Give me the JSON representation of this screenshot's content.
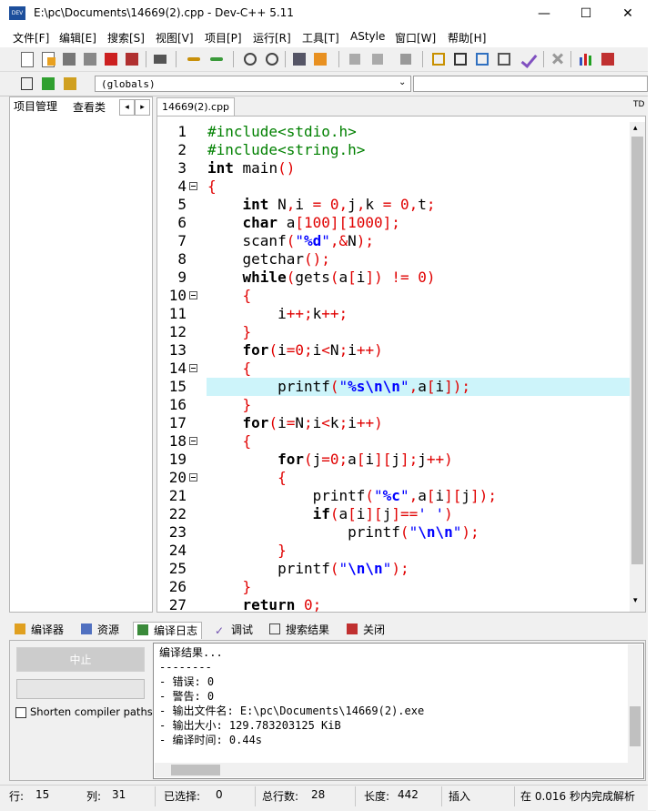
{
  "window": {
    "title": "E:\\pc\\Documents\\14669(2).cpp - Dev-C++ 5.11",
    "minimize": "—",
    "maximize": "☐",
    "close": "✕"
  },
  "menu": [
    "文件[F]",
    "编辑[E]",
    "搜索[S]",
    "视图[V]",
    "项目[P]",
    "运行[R]",
    "工具[T]",
    "AStyle",
    "窗口[W]",
    "帮助[H]"
  ],
  "toolbar": {
    "globals_value": "(globals)",
    "right_cut_label": "TD"
  },
  "left_panel": {
    "tabs": [
      "项目管理",
      "查看类"
    ],
    "nav_prev": "◂",
    "nav_next": "▸"
  },
  "editor": {
    "tab_label": "14669(2).cpp",
    "current_line": 15,
    "line_numbers": [
      "1",
      "2",
      "3",
      "4",
      "5",
      "6",
      "7",
      "8",
      "9",
      "10",
      "11",
      "12",
      "13",
      "14",
      "15",
      "16",
      "17",
      "18",
      "19",
      "20",
      "21",
      "22",
      "23",
      "24",
      "25",
      "26",
      "27"
    ],
    "fold_lines": [
      4,
      10,
      14,
      18,
      20
    ]
  },
  "bottom_tabs": [
    "编译器",
    "资源",
    "编译日志",
    "调试",
    "搜索结果",
    "关闭"
  ],
  "bottom_panel": {
    "abort_label": "中止",
    "shorten_label": "Shorten compiler paths",
    "log_lines": [
      "编译结果...",
      "--------",
      "- 错误: 0",
      "- 警告: 0",
      "- 输出文件名: E:\\pc\\Documents\\14669(2).exe",
      "- 输出大小: 129.783203125 KiB",
      "- 编译时间: 0.44s"
    ]
  },
  "status": {
    "line_label": "行:",
    "line_value": "15",
    "col_label": "列:",
    "col_value": "31",
    "sel_label": "已选择:",
    "sel_value": "0",
    "total_label": "总行数:",
    "total_value": "28",
    "len_label": "长度:",
    "len_value": "442",
    "mode": "插入",
    "parse_msg": "在 0.016 秒内完成解析"
  },
  "colors": {
    "keyword": "#000000",
    "preprocessor": "#008000",
    "symbol": "#e00000",
    "string": "#0000ff",
    "current_line": "#cdf4fa"
  }
}
